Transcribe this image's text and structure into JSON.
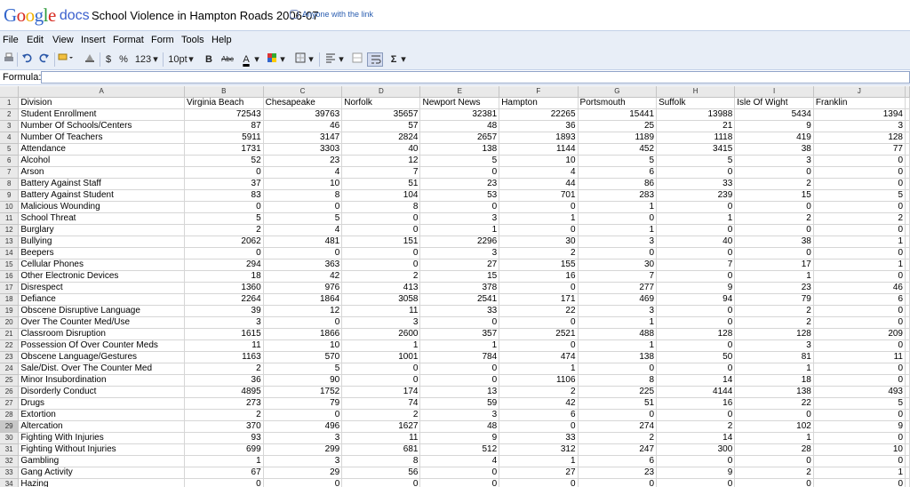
{
  "header": {
    "logo_google": "Google",
    "logo_docs": "docs",
    "title": "School Violence in Hampton Roads 2006-07",
    "share_text": "Anyone with the link"
  },
  "menu": [
    "File",
    "Edit",
    "View",
    "Insert",
    "Format",
    "Form",
    "Tools",
    "Help"
  ],
  "toolbar": {
    "currency": "$",
    "percent": "%",
    "number_format": "123",
    "font_size": "10pt",
    "bold": "B",
    "strike": "Abc",
    "text_color": "A",
    "sum": "Σ"
  },
  "formula": {
    "label": "Formula:",
    "value": ""
  },
  "colors": {
    "logo_blue": "#3366cc",
    "logo_red": "#d72a20",
    "logo_yellow": "#f2b100",
    "logo_green": "#2d9b3a",
    "toolbar_bg": "#e8eef7"
  },
  "sheet": {
    "col_letters": [
      "A",
      "B",
      "C",
      "D",
      "E",
      "F",
      "G",
      "H",
      "I",
      "J"
    ],
    "selected_row": 29,
    "rows": [
      [
        "Division",
        "Virginia Beach",
        "Chesapeake",
        "Norfolk",
        "Newport News",
        "Hampton",
        "Portsmouth",
        "Suffolk",
        "Isle Of Wight",
        "Franklin"
      ],
      [
        "Student Enrollment",
        "72543",
        "39763",
        "35657",
        "32381",
        "22265",
        "15441",
        "13988",
        "5434",
        "1394"
      ],
      [
        "Number Of Schools/Centers",
        "87",
        "46",
        "57",
        "48",
        "36",
        "25",
        "21",
        "9",
        "3"
      ],
      [
        "Number Of Teachers",
        "5911",
        "3147",
        "2824",
        "2657",
        "1893",
        "1189",
        "1118",
        "419",
        "128"
      ],
      [
        "Attendance",
        "1731",
        "3303",
        "40",
        "138",
        "1144",
        "452",
        "3415",
        "38",
        "77"
      ],
      [
        "Alcohol",
        "52",
        "23",
        "12",
        "5",
        "10",
        "5",
        "5",
        "3",
        "0"
      ],
      [
        "Arson",
        "0",
        "4",
        "7",
        "0",
        "4",
        "6",
        "0",
        "0",
        "0"
      ],
      [
        "Battery Against Staff",
        "37",
        "10",
        "51",
        "23",
        "44",
        "86",
        "33",
        "2",
        "0"
      ],
      [
        "Battery Against Student",
        "83",
        "8",
        "104",
        "53",
        "701",
        "283",
        "239",
        "15",
        "5"
      ],
      [
        "Malicious Wounding",
        "0",
        "0",
        "8",
        "0",
        "0",
        "1",
        "0",
        "0",
        "0"
      ],
      [
        "School Threat",
        "5",
        "5",
        "0",
        "3",
        "1",
        "0",
        "1",
        "2",
        "2"
      ],
      [
        "Burglary",
        "2",
        "4",
        "0",
        "1",
        "0",
        "1",
        "0",
        "0",
        "0"
      ],
      [
        "Bullying",
        "2062",
        "481",
        "151",
        "2296",
        "30",
        "3",
        "40",
        "38",
        "1"
      ],
      [
        "Beepers",
        "0",
        "0",
        "0",
        "3",
        "2",
        "0",
        "0",
        "0",
        "0"
      ],
      [
        "Cellular Phones",
        "294",
        "363",
        "0",
        "27",
        "155",
        "30",
        "7",
        "17",
        "1"
      ],
      [
        "Other Electronic Devices",
        "18",
        "42",
        "2",
        "15",
        "16",
        "7",
        "0",
        "1",
        "0"
      ],
      [
        "Disrespect",
        "1360",
        "976",
        "413",
        "378",
        "0",
        "277",
        "9",
        "23",
        "46"
      ],
      [
        "Defiance",
        "2264",
        "1864",
        "3058",
        "2541",
        "171",
        "469",
        "94",
        "79",
        "6"
      ],
      [
        "Obscene Disruptive Language",
        "39",
        "12",
        "11",
        "33",
        "22",
        "3",
        "0",
        "2",
        "0"
      ],
      [
        "Over The Counter Med/Use",
        "3",
        "0",
        "3",
        "0",
        "0",
        "1",
        "0",
        "2",
        "0"
      ],
      [
        "Classroom Disruption",
        "1615",
        "1866",
        "2600",
        "357",
        "2521",
        "488",
        "128",
        "128",
        "209"
      ],
      [
        "Possession Of Over Counter Meds",
        "11",
        "10",
        "1",
        "1",
        "0",
        "1",
        "0",
        "3",
        "0"
      ],
      [
        "Obscene Language/Gestures",
        "1163",
        "570",
        "1001",
        "784",
        "474",
        "138",
        "50",
        "81",
        "11"
      ],
      [
        "Sale/Dist. Over The Counter Med",
        "2",
        "5",
        "0",
        "0",
        "1",
        "0",
        "0",
        "1",
        "0"
      ],
      [
        "Minor Insubordination",
        "36",
        "90",
        "0",
        "0",
        "1106",
        "8",
        "14",
        "18",
        "0"
      ],
      [
        "Disorderly Conduct",
        "4895",
        "1752",
        "174",
        "13",
        "2",
        "225",
        "4144",
        "138",
        "493"
      ],
      [
        "Drugs",
        "273",
        "79",
        "74",
        "59",
        "42",
        "51",
        "16",
        "22",
        "5"
      ],
      [
        "Extortion",
        "2",
        "0",
        "2",
        "3",
        "6",
        "0",
        "0",
        "0",
        "0"
      ],
      [
        "Altercation",
        "370",
        "496",
        "1627",
        "48",
        "0",
        "274",
        "2",
        "102",
        "9"
      ],
      [
        "Fighting With Injuries",
        "93",
        "3",
        "11",
        "9",
        "33",
        "2",
        "14",
        "1",
        "0"
      ],
      [
        "Fighting Without Injuries",
        "699",
        "299",
        "681",
        "512",
        "312",
        "247",
        "300",
        "28",
        "10"
      ],
      [
        "Gambling",
        "1",
        "3",
        "8",
        "4",
        "1",
        "6",
        "0",
        "0",
        "0"
      ],
      [
        "Gang Activity",
        "67",
        "29",
        "56",
        "0",
        "27",
        "23",
        "9",
        "2",
        "1"
      ],
      [
        "Hazing",
        "0",
        "0",
        "0",
        "0",
        "0",
        "0",
        "0",
        "0",
        "0"
      ]
    ]
  }
}
